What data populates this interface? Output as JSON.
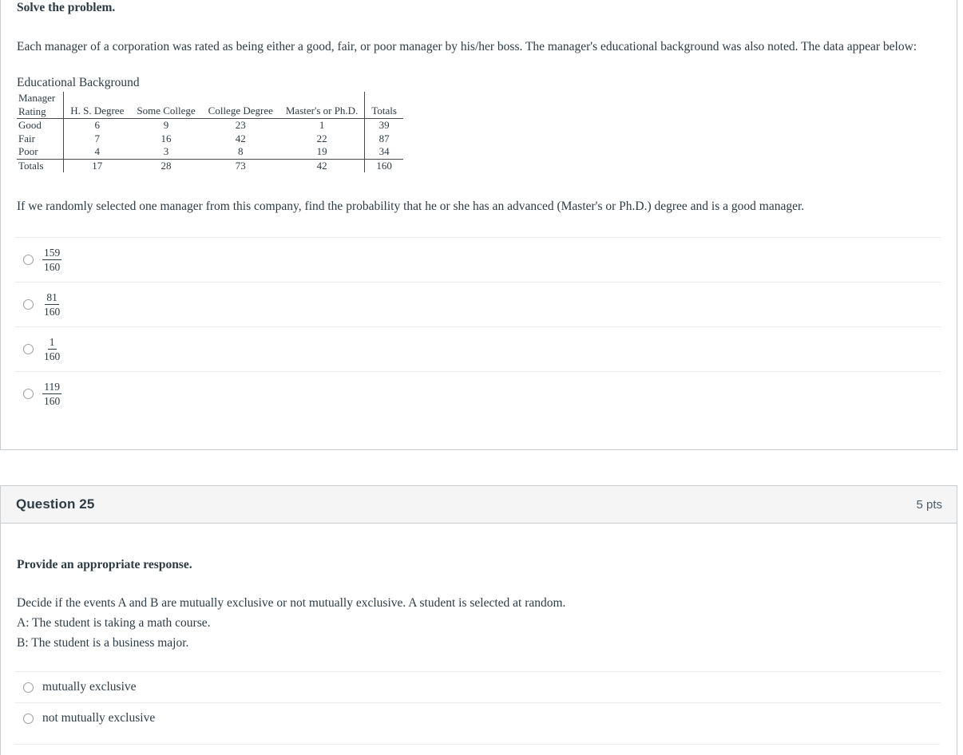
{
  "question_24": {
    "prompt_bold": "Solve the problem.",
    "intro": "Each manager of a corporation was rated as being either a good, fair, or poor manager by his/her boss. The manager's educational background was also noted. The data appear below:",
    "table": {
      "caption": "Educational Background",
      "corner_label_line1": "Manager",
      "corner_label_line2": "Rating",
      "columns": [
        "H. S. Degree",
        "Some College",
        "College Degree",
        "Master's or Ph.D.",
        "Totals"
      ],
      "rows": [
        {
          "label": "Good",
          "values": [
            "6",
            "9",
            "23",
            "1",
            "39"
          ]
        },
        {
          "label": "Fair",
          "values": [
            "7",
            "16",
            "42",
            "22",
            "87"
          ]
        },
        {
          "label": "Poor",
          "values": [
            "4",
            "3",
            "8",
            "19",
            "34"
          ]
        }
      ],
      "totals_row": {
        "label": "Totals",
        "values": [
          "17",
          "28",
          "73",
          "42",
          "160"
        ]
      }
    },
    "question_text": "If we randomly selected one manager from this company, find the probability that he or she has an advanced (Master's or Ph.D.) degree and is a good manager.",
    "options": [
      {
        "numerator": "159",
        "denominator": "160"
      },
      {
        "numerator": "81",
        "denominator": "160"
      },
      {
        "numerator": "1",
        "denominator": "160"
      },
      {
        "numerator": "119",
        "denominator": "160"
      }
    ]
  },
  "question_25": {
    "header_title": "Question 25",
    "header_points": "5 pts",
    "prompt_bold": "Provide an appropriate response.",
    "line1": "Decide if the events A and B are mutually exclusive or not mutually exclusive. A student is selected at random.",
    "line2": "A: The student is taking a math course.",
    "line3": "B: The student is a business major.",
    "options": [
      {
        "label": "mutually exclusive"
      },
      {
        "label": "not mutually exclusive"
      }
    ]
  },
  "colors": {
    "text": "#2d3b45",
    "border": "#c7cdd1",
    "header_bg": "#f5f5f5",
    "divider": "#e8eaec"
  }
}
